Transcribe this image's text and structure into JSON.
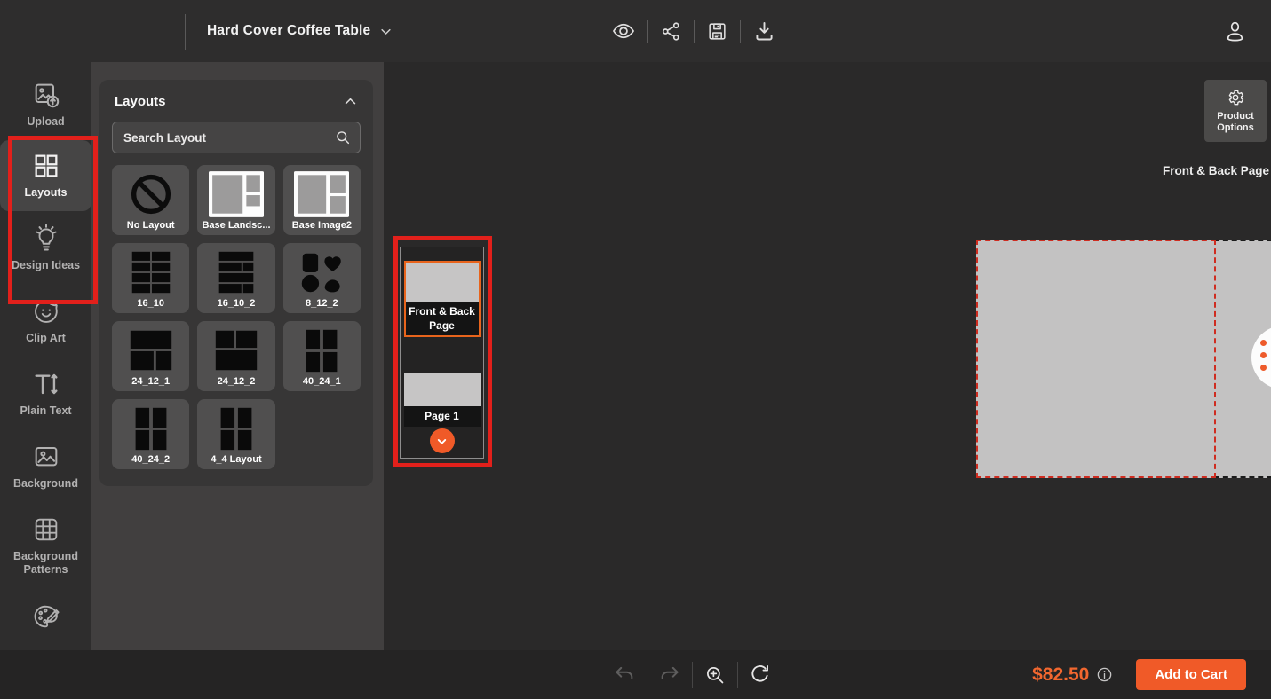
{
  "topbar": {
    "title": "Hard Cover Coffee Table",
    "icons": {
      "title_chevron": "chevron-down-icon",
      "preview": "eye-icon",
      "share": "share-icon",
      "save": "floppy-save-icon",
      "download": "download-icon",
      "account": "user-icon"
    }
  },
  "sidebar": {
    "items": [
      {
        "label": "Upload",
        "icon": "image-upload-icon",
        "active": false
      },
      {
        "label": "Layouts",
        "icon": "layout-grid-icon",
        "active": true
      },
      {
        "label": "Design Ideas",
        "icon": "lightbulb-icon",
        "active": false
      },
      {
        "label": "Clip Art",
        "icon": "sticker-icon",
        "active": false
      },
      {
        "label": "Plain Text",
        "icon": "text-resize-icon",
        "active": false
      },
      {
        "label": "Background",
        "icon": "image-icon",
        "active": false
      },
      {
        "label": "Background Patterns",
        "icon": "pattern-grid-icon",
        "active": false
      },
      {
        "label": "",
        "icon": "palette-brush-icon",
        "active": false
      }
    ]
  },
  "layouts_panel": {
    "title": "Layouts",
    "search_placeholder": "Search Layout",
    "collapse_icon": "chevron-up-icon",
    "tiles": [
      {
        "label": "No Layout",
        "art": "no-layout"
      },
      {
        "label": "Base Landsc...",
        "art": "base-landscape"
      },
      {
        "label": "Base Image2",
        "art": "base-image2"
      },
      {
        "label": "16_10",
        "art": "grid-2x4"
      },
      {
        "label": "16_10_2",
        "art": "rows-mixed"
      },
      {
        "label": "8_12_2",
        "art": "shapes"
      },
      {
        "label": "24_12_1",
        "art": "top-full"
      },
      {
        "label": "24_12_2",
        "art": "bottom-full"
      },
      {
        "label": "40_24_1",
        "art": "grid-2x2"
      },
      {
        "label": "40_24_2",
        "art": "grid-2x2"
      },
      {
        "label": "4_4 Layout",
        "art": "grid-2x2"
      }
    ]
  },
  "pages_panel": {
    "pages": [
      {
        "label": "Front & Back Page",
        "selected": true
      },
      {
        "label": "Page 1",
        "selected": false
      }
    ],
    "more_pages_icon": "chevron-down-icon"
  },
  "canvas": {
    "title": "Front & Back Page"
  },
  "product_options": {
    "label": "Product Options",
    "icon": "gear-icon"
  },
  "bottom_bar": {
    "price": "$82.50",
    "add_to_cart_label": "Add to Cart",
    "icons": [
      "undo-icon",
      "redo-icon",
      "zoom-in-icon",
      "rotate-icon",
      "info-icon"
    ]
  },
  "colors": {
    "accent_orange": "#f05a28",
    "price_orange": "#f2672f",
    "annotation_red": "#e2201b",
    "selection_orange": "#e8641c",
    "page_gray": "#c3c2c2",
    "page_border_red": "#cf2c20",
    "page_border_black": "#1b1b1b"
  }
}
